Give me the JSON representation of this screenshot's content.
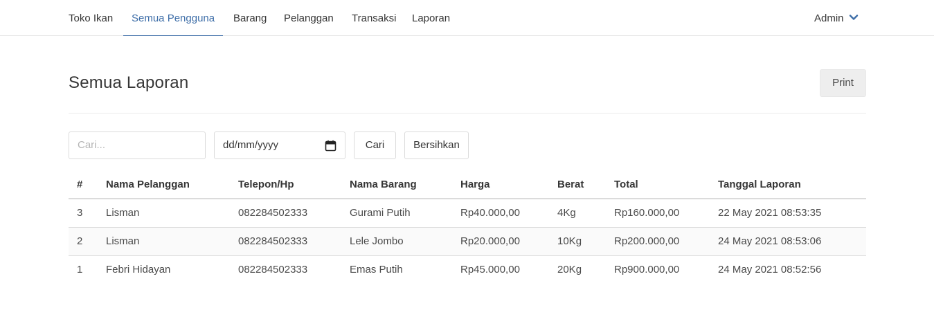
{
  "nav": {
    "brand": "Toko Ikan",
    "items": [
      {
        "label": "Semua Pengguna",
        "active": true
      },
      {
        "label": "Barang"
      },
      {
        "label": "Pelanggan"
      },
      {
        "label": "Transaksi"
      },
      {
        "label": "Laporan"
      }
    ],
    "user": "Admin",
    "user_icon": "chevron-down-icon",
    "accent_color": "#3e6ea8"
  },
  "page": {
    "title": "Semua Laporan",
    "print_label": "Print"
  },
  "filters": {
    "search_placeholder": "Cari...",
    "date_placeholder": "dd/mm/yyyy",
    "date_icon": "calendar-icon",
    "search_button": "Cari",
    "clear_button": "Bersihkan"
  },
  "table": {
    "headers": [
      "#",
      "Nama Pelanggan",
      "Telepon/Hp",
      "Nama Barang",
      "Harga",
      "Berat",
      "Total",
      "Tanggal Laporan"
    ],
    "rows": [
      [
        "3",
        "Lisman",
        "082284502333",
        "Gurami Putih",
        "Rp40.000,00",
        "4Kg",
        "Rp160.000,00",
        "22 May 2021 08:53:35"
      ],
      [
        "2",
        "Lisman",
        "082284502333",
        "Lele Jombo",
        "Rp20.000,00",
        "10Kg",
        "Rp200.000,00",
        "24 May 2021 08:53:06"
      ],
      [
        "1",
        "Febri Hidayan",
        "082284502333",
        "Emas Putih",
        "Rp45.000,00",
        "20Kg",
        "Rp900.000,00",
        "24 May 2021 08:52:56"
      ]
    ]
  }
}
